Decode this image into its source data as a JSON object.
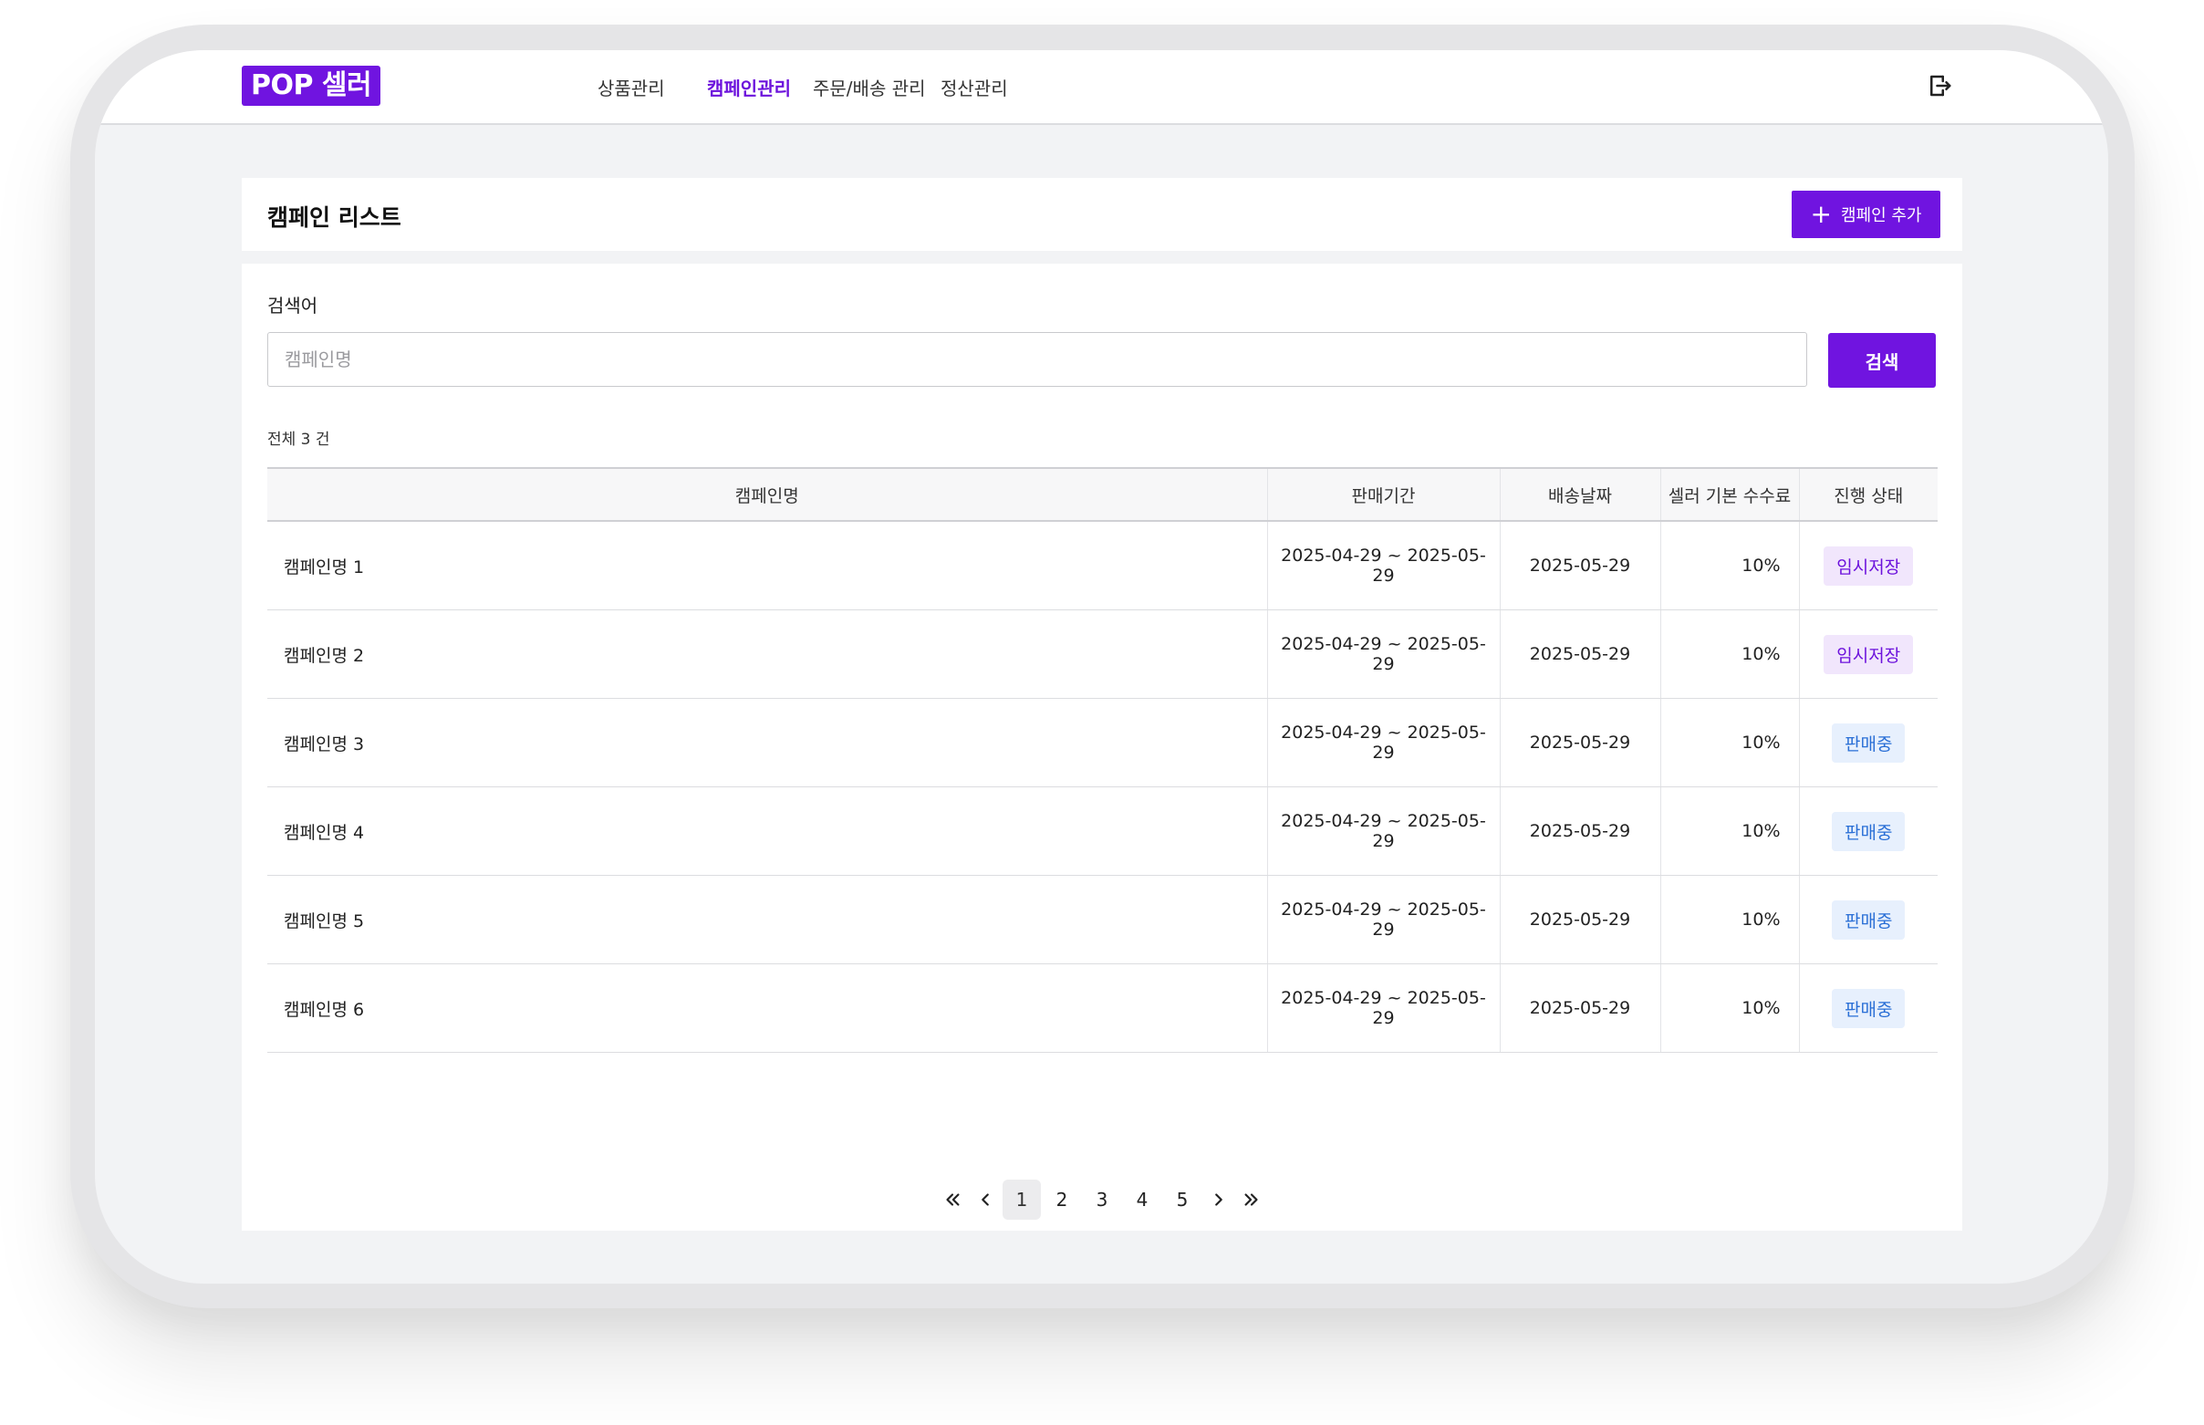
{
  "brand": {
    "logo_text": "POP 셀러",
    "accent_color": "#7014e0"
  },
  "nav": {
    "items": [
      {
        "label": "상품관리",
        "active": false
      },
      {
        "label": "캠페인관리",
        "active": true
      },
      {
        "label": "주문/배송 관리",
        "active": false
      },
      {
        "label": "정산관리",
        "active": false
      }
    ],
    "logout_icon": "logout-icon"
  },
  "page": {
    "title": "캠페인 리스트",
    "add_button_label": "캠페인 추가"
  },
  "search": {
    "label": "검색어",
    "placeholder": "캠페인명",
    "value": "",
    "button_label": "검색"
  },
  "list": {
    "total_text": "전체 3 건",
    "columns": [
      "캠페인명",
      "판매기간",
      "배송날짜",
      "셀러 기본 수수료",
      "진행 상태"
    ],
    "rows": [
      {
        "name": "캠페인명 1",
        "period": "2025-04-29 ~ 2025-05-29",
        "delivery_date": "2025-05-29",
        "fee": "10%",
        "status": "임시저장",
        "status_type": "draft"
      },
      {
        "name": "캠페인명 2",
        "period": "2025-04-29 ~ 2025-05-29",
        "delivery_date": "2025-05-29",
        "fee": "10%",
        "status": "임시저장",
        "status_type": "draft"
      },
      {
        "name": "캠페인명 3",
        "period": "2025-04-29 ~ 2025-05-29",
        "delivery_date": "2025-05-29",
        "fee": "10%",
        "status": "판매중",
        "status_type": "sale"
      },
      {
        "name": "캠페인명 4",
        "period": "2025-04-29 ~ 2025-05-29",
        "delivery_date": "2025-05-29",
        "fee": "10%",
        "status": "판매중",
        "status_type": "sale"
      },
      {
        "name": "캠페인명 5",
        "period": "2025-04-29 ~ 2025-05-29",
        "delivery_date": "2025-05-29",
        "fee": "10%",
        "status": "판매중",
        "status_type": "sale"
      },
      {
        "name": "캠페인명 6",
        "period": "2025-04-29 ~ 2025-05-29",
        "delivery_date": "2025-05-29",
        "fee": "10%",
        "status": "판매중",
        "status_type": "sale"
      }
    ]
  },
  "pagination": {
    "pages": [
      "1",
      "2",
      "3",
      "4",
      "5"
    ],
    "current": "1"
  },
  "status_colors": {
    "draft": "#6c12dc",
    "sale": "#2a6fd6"
  }
}
